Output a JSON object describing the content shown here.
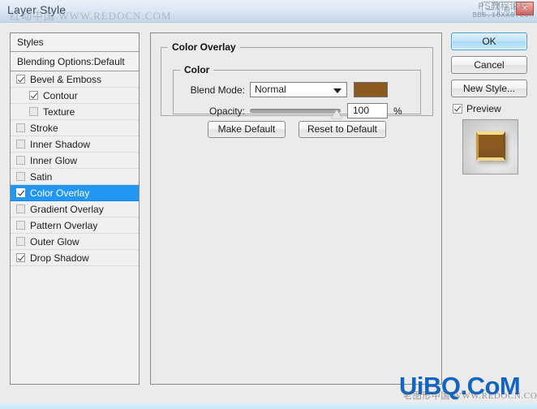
{
  "window": {
    "title": "Layer Style",
    "buttons": [
      {
        "name": "minimize",
        "glyph": "—"
      },
      {
        "name": "maximize",
        "glyph": "□"
      },
      {
        "name": "close",
        "glyph": "✕"
      }
    ]
  },
  "watermarks": {
    "title_overlay": "红动中国 WWW.REDOCN.COM",
    "topright_line1": "PS教程论坛",
    "topright_line2": "BBS.16XX8.COM",
    "bottom": "UiBQ.CoM",
    "bottom_sub": "老图形中国 WWW.REDOCN.COM"
  },
  "styles_panel": {
    "header": "Styles",
    "blending_options": "Blending Options:Default",
    "items": [
      {
        "label": "Bevel & Emboss",
        "checked": true,
        "indent": false,
        "selected": false,
        "dim": false
      },
      {
        "label": "Contour",
        "checked": true,
        "indent": true,
        "selected": false,
        "dim": false
      },
      {
        "label": "Texture",
        "checked": false,
        "indent": true,
        "selected": false,
        "dim": true
      },
      {
        "label": "Stroke",
        "checked": false,
        "indent": false,
        "selected": false,
        "dim": true
      },
      {
        "label": "Inner Shadow",
        "checked": false,
        "indent": false,
        "selected": false,
        "dim": true
      },
      {
        "label": "Inner Glow",
        "checked": false,
        "indent": false,
        "selected": false,
        "dim": true
      },
      {
        "label": "Satin",
        "checked": false,
        "indent": false,
        "selected": false,
        "dim": true
      },
      {
        "label": "Color Overlay",
        "checked": true,
        "indent": false,
        "selected": true,
        "dim": false
      },
      {
        "label": "Gradient Overlay",
        "checked": false,
        "indent": false,
        "selected": false,
        "dim": true
      },
      {
        "label": "Pattern Overlay",
        "checked": false,
        "indent": false,
        "selected": false,
        "dim": true
      },
      {
        "label": "Outer Glow",
        "checked": false,
        "indent": false,
        "selected": false,
        "dim": true
      },
      {
        "label": "Drop Shadow",
        "checked": true,
        "indent": false,
        "selected": false,
        "dim": false
      }
    ]
  },
  "main_panel": {
    "group_title": "Color Overlay",
    "subgroup_title": "Color",
    "blend_mode": {
      "label": "Blend Mode:",
      "value": "Normal",
      "swatch_color": "#8b5a1e"
    },
    "opacity": {
      "label": "Opacity:",
      "value": "100",
      "unit": "%",
      "slider_percent": 100
    },
    "make_default": "Make Default",
    "reset_to_default": "Reset to Default"
  },
  "right_column": {
    "ok": "OK",
    "cancel": "Cancel",
    "new_style": "New Style...",
    "preview_label": "Preview",
    "preview_checked": true
  },
  "colors": {
    "selection_blue": "#2196f3",
    "overlay_brown": "#8b5a1e",
    "watermark_blue": "#1565c0"
  }
}
